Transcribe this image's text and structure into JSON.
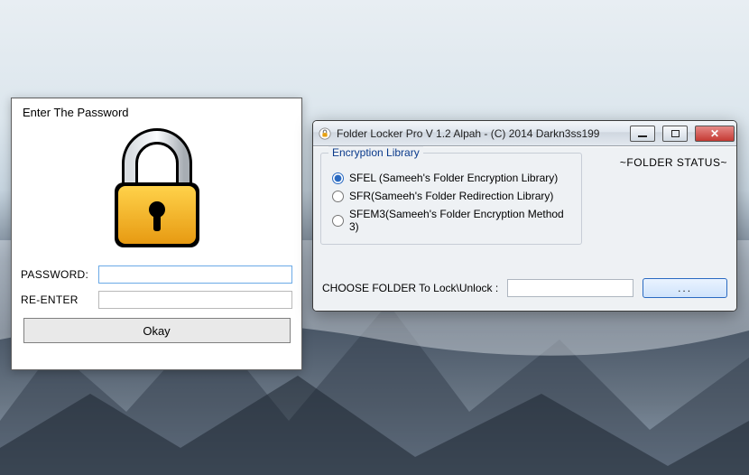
{
  "password_dialog": {
    "title": "Enter The Password",
    "password_label": "PASSWORD:",
    "reenter_label": "RE-ENTER",
    "password_value": "",
    "reenter_value": "",
    "ok_label": "Okay"
  },
  "main_window": {
    "title": "Folder Locker Pro V 1.2 Alpah - (C) 2014 Darkn3ss199",
    "groupbox_title": "Encryption Library",
    "options": [
      {
        "label": "SFEL (Sameeh's Folder Encryption Library)",
        "selected": true
      },
      {
        "label": "SFR(Sameeh's Folder Redirection Library)",
        "selected": false
      },
      {
        "label": "SFEM3(Sameeh's Folder Encryption Method 3)",
        "selected": false
      }
    ],
    "status_label": "~FOLDER STATUS~",
    "choose_label": "CHOOSE FOLDER To Lock\\Unlock :",
    "folder_value": "",
    "browse_label": "..."
  }
}
